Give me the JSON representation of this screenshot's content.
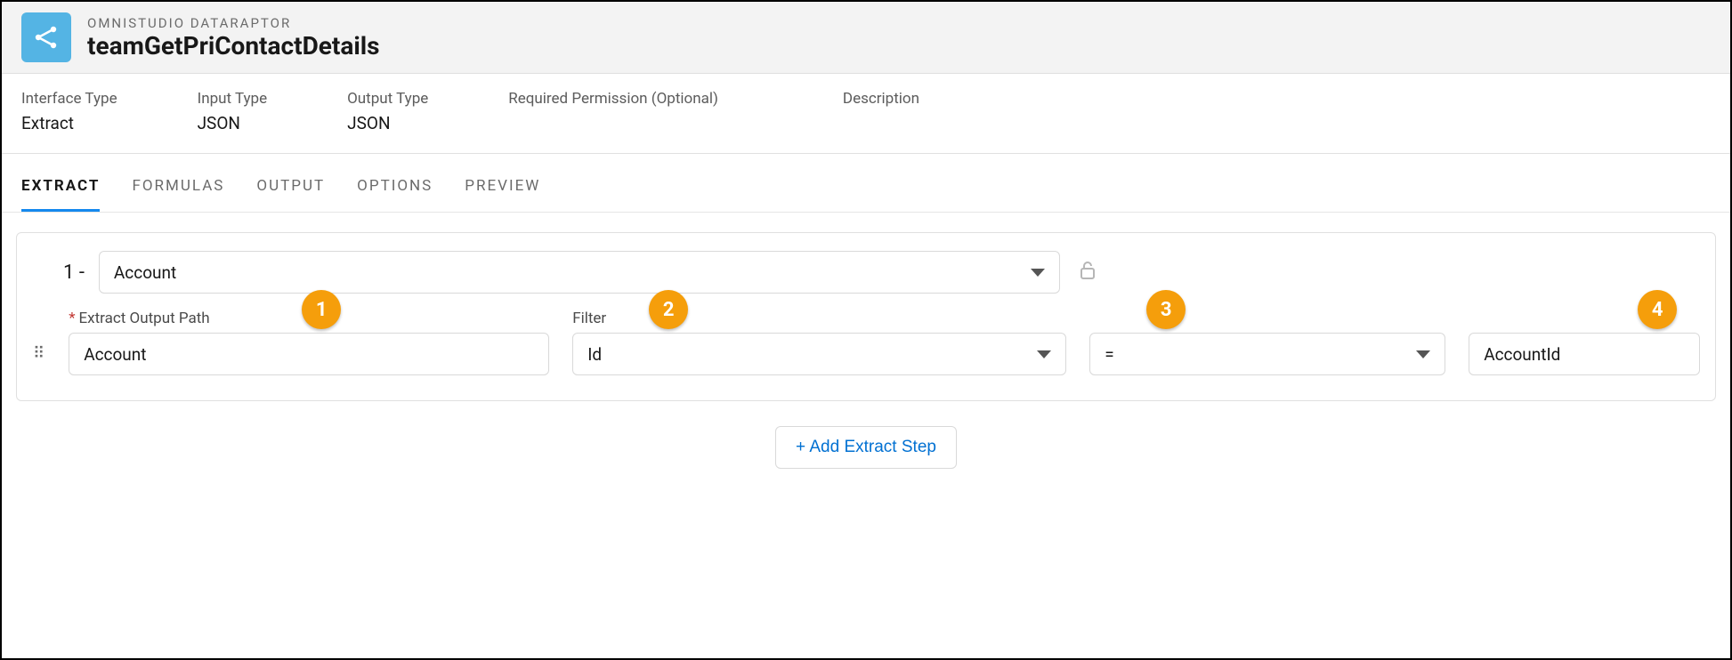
{
  "header": {
    "eyebrow": "OMNISTUDIO DATARAPTOR",
    "title": "teamGetPriContactDetails"
  },
  "meta": {
    "interface_type_label": "Interface Type",
    "interface_type_value": "Extract",
    "input_type_label": "Input Type",
    "input_type_value": "JSON",
    "output_type_label": "Output Type",
    "output_type_value": "JSON",
    "required_permission_label": "Required Permission (Optional)",
    "required_permission_value": "",
    "description_label": "Description",
    "description_value": ""
  },
  "tabs": {
    "extract": "EXTRACT",
    "formulas": "FORMULAS",
    "output": "OUTPUT",
    "options": "OPTIONS",
    "preview": "PREVIEW"
  },
  "step": {
    "index_text": "1 -",
    "object_value": "Account",
    "output_path_label": "Extract Output Path",
    "output_path_value": "Account",
    "filter_label": "Filter",
    "filter_field_value": "Id",
    "filter_operator_value": "=",
    "filter_compare_value": "AccountId"
  },
  "badges": {
    "b1": "1",
    "b2": "2",
    "b3": "3",
    "b4": "4"
  },
  "actions": {
    "add_step": "+ Add Extract Step"
  }
}
